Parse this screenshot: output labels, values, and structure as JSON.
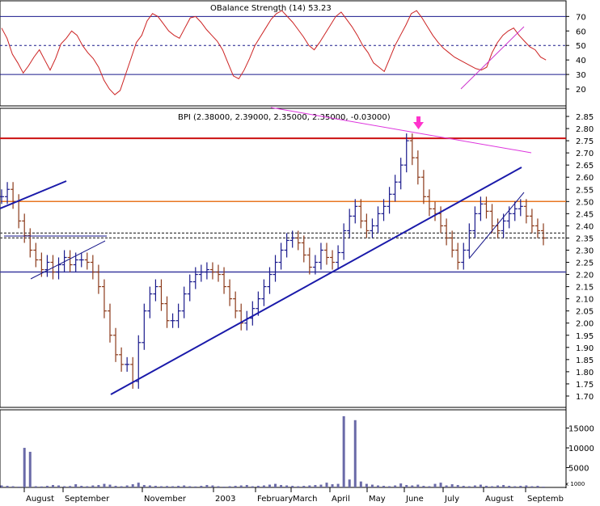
{
  "chart_data": [
    {
      "type": "line",
      "panel": "rsi",
      "title": "OBalance Strength (14) 53.23",
      "ylim": [
        10,
        78
      ],
      "yticks": [
        20,
        30,
        40,
        50,
        60,
        70
      ],
      "reference_lines": [
        {
          "value": 70,
          "style": "solid",
          "color": "#1a1a8c"
        },
        {
          "value": 50,
          "style": "dashed",
          "color": "#1a1a8c"
        },
        {
          "value": 30,
          "style": "solid",
          "color": "#1a1a8c"
        }
      ],
      "series": [
        {
          "color": "#cc2222",
          "values": [
            62,
            55,
            44,
            38,
            31,
            36,
            42,
            47,
            40,
            33,
            41,
            51,
            55,
            60,
            57,
            50,
            45,
            41,
            35,
            26,
            20,
            16,
            19,
            30,
            41,
            52,
            57,
            67,
            72,
            70,
            65,
            60,
            57,
            55,
            62,
            69,
            70,
            66,
            61,
            57,
            53,
            47,
            38,
            29,
            27,
            33,
            41,
            50,
            56,
            62,
            68,
            72,
            74,
            70,
            66,
            61,
            56,
            50,
            47,
            52,
            58,
            64,
            70,
            73,
            68,
            63,
            57,
            50,
            45,
            38,
            35,
            32,
            41,
            50,
            57,
            64,
            72,
            74,
            69,
            63,
            57,
            52,
            48,
            45,
            42,
            40,
            38,
            36,
            34,
            33,
            35,
            45,
            52,
            57,
            60,
            62,
            57,
            53,
            49,
            47,
            42,
            40
          ]
        }
      ]
    },
    {
      "type": "candlestick",
      "panel": "price",
      "title": "BPI (2.38000, 2.39000, 2.35000, 2.35000, -0.03000)",
      "ylim": [
        1.66,
        2.88
      ],
      "yticks": [
        "2.85",
        "2.80",
        "2.75",
        "2.70",
        "2.65",
        "2.60",
        "2.55",
        "2.50",
        "2.45",
        "2.40",
        "2.35",
        "2.30",
        "2.25",
        "2.20",
        "2.15",
        "2.10",
        "2.05",
        "2.00",
        "1.95",
        "1.90",
        "1.85",
        "1.80",
        "1.75",
        "1.70"
      ],
      "series": [
        {
          "name": "close",
          "color": "#1a1a8c",
          "values": [
            2.52,
            2.55,
            2.5,
            2.42,
            2.36,
            2.3,
            2.26,
            2.22,
            2.25,
            2.21,
            2.24,
            2.27,
            2.24,
            2.26,
            2.26,
            2.25,
            2.21,
            2.15,
            2.05,
            1.95,
            1.87,
            1.83,
            1.83,
            1.76,
            1.92,
            2.05,
            2.12,
            2.15,
            2.08,
            2.01,
            2.01,
            2.05,
            2.12,
            2.17,
            2.2,
            2.21,
            2.22,
            2.21,
            2.2,
            2.15,
            2.1,
            2.05,
            2.0,
            2.02,
            2.06,
            2.1,
            2.15,
            2.2,
            2.25,
            2.3,
            2.34,
            2.35,
            2.33,
            2.28,
            2.23,
            2.25,
            2.3,
            2.27,
            2.25,
            2.29,
            2.38,
            2.44,
            2.48,
            2.42,
            2.38,
            2.4,
            2.45,
            2.48,
            2.53,
            2.58,
            2.65,
            2.75,
            2.68,
            2.6,
            2.52,
            2.47,
            2.45,
            2.4,
            2.35,
            2.3,
            2.25,
            2.3,
            2.38,
            2.45,
            2.49,
            2.46,
            2.4,
            2.38,
            2.42,
            2.45,
            2.47,
            2.48,
            2.44,
            2.4,
            2.38,
            2.35
          ]
        }
      ],
      "reference_lines": [
        {
          "value": 2.76,
          "color": "#cc1111",
          "style": "solid"
        },
        {
          "value": 2.5,
          "color": "#e87722",
          "style": "solid"
        },
        {
          "value": 2.37,
          "color": "#555555",
          "style": "dashed"
        },
        {
          "value": 2.35,
          "color": "#555555",
          "style": "dashed"
        },
        {
          "value": 2.21,
          "color": "#3a3aa0",
          "style": "solid"
        }
      ]
    },
    {
      "type": "bar",
      "panel": "volume",
      "ylim": [
        0,
        19000
      ],
      "yticks": [
        "15000",
        "10000",
        "5000"
      ],
      "unit_label": "x 1000",
      "values": [
        500,
        400,
        300,
        200,
        10000,
        9000,
        300,
        250,
        400,
        600,
        500,
        300,
        350,
        800,
        400,
        300,
        500,
        600,
        900,
        700,
        400,
        300,
        500,
        800,
        1200,
        600,
        500,
        400,
        300,
        350,
        300,
        400,
        500,
        300,
        250,
        400,
        600,
        500,
        300,
        200,
        300,
        400,
        500,
        600,
        300,
        400,
        500,
        700,
        900,
        600,
        500,
        400,
        300,
        400,
        500,
        600,
        700,
        1200,
        800,
        900,
        18000,
        2000,
        17000,
        1500,
        900,
        700,
        500,
        400,
        300,
        500,
        1000,
        600,
        500,
        700,
        400,
        300,
        900,
        1200,
        500,
        800,
        600,
        400,
        300,
        500,
        700,
        400,
        300,
        500,
        600,
        400,
        300,
        400,
        500,
        300,
        400,
        200
      ]
    }
  ],
  "x_axis": {
    "labels": [
      "August",
      "September",
      "November",
      "2003",
      "February",
      "March",
      "April",
      "May",
      "June",
      "July",
      "August",
      "Septemb"
    ]
  },
  "annotations": {
    "arrow_color": "#ff33cc"
  }
}
